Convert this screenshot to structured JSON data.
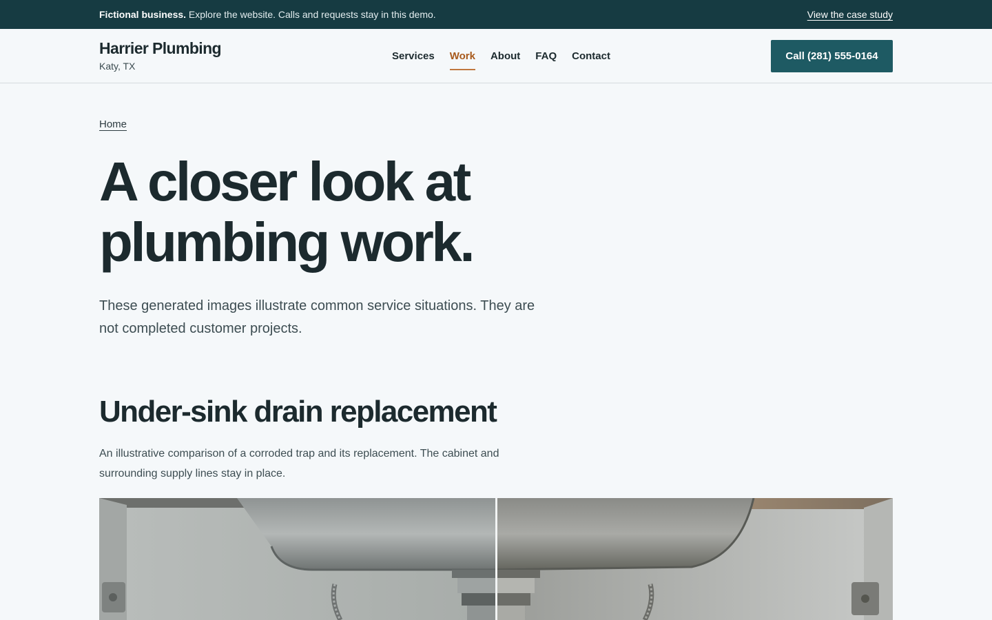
{
  "banner": {
    "bold": "Fictional business.",
    "text": " Explore the website. Calls and requests stay in this demo.",
    "link": "View the case study"
  },
  "brand": {
    "name": "Harrier Plumbing",
    "location": "Katy, TX"
  },
  "nav": {
    "items": [
      {
        "label": "Services"
      },
      {
        "label": "Work",
        "active": true
      },
      {
        "label": "About"
      },
      {
        "label": "FAQ"
      },
      {
        "label": "Contact"
      }
    ]
  },
  "header": {
    "call_label": "Call (281) 555-0164"
  },
  "breadcrumb": {
    "home": "Home"
  },
  "hero": {
    "title_line1": "A closer look at",
    "title_line2": "plumbing work.",
    "subtitle": "These generated images illustrate common service situations. They are not completed customer projects."
  },
  "section": {
    "title": "Under-sink drain replacement",
    "description": "An illustrative comparison of a corroded trap and its replacement. The cabinet and surrounding supply lines stay in place."
  },
  "colors": {
    "banner_bg": "#163b42",
    "accent": "#a85a1c",
    "button_bg": "#1e5a63",
    "page_bg": "#f5f8fa"
  }
}
